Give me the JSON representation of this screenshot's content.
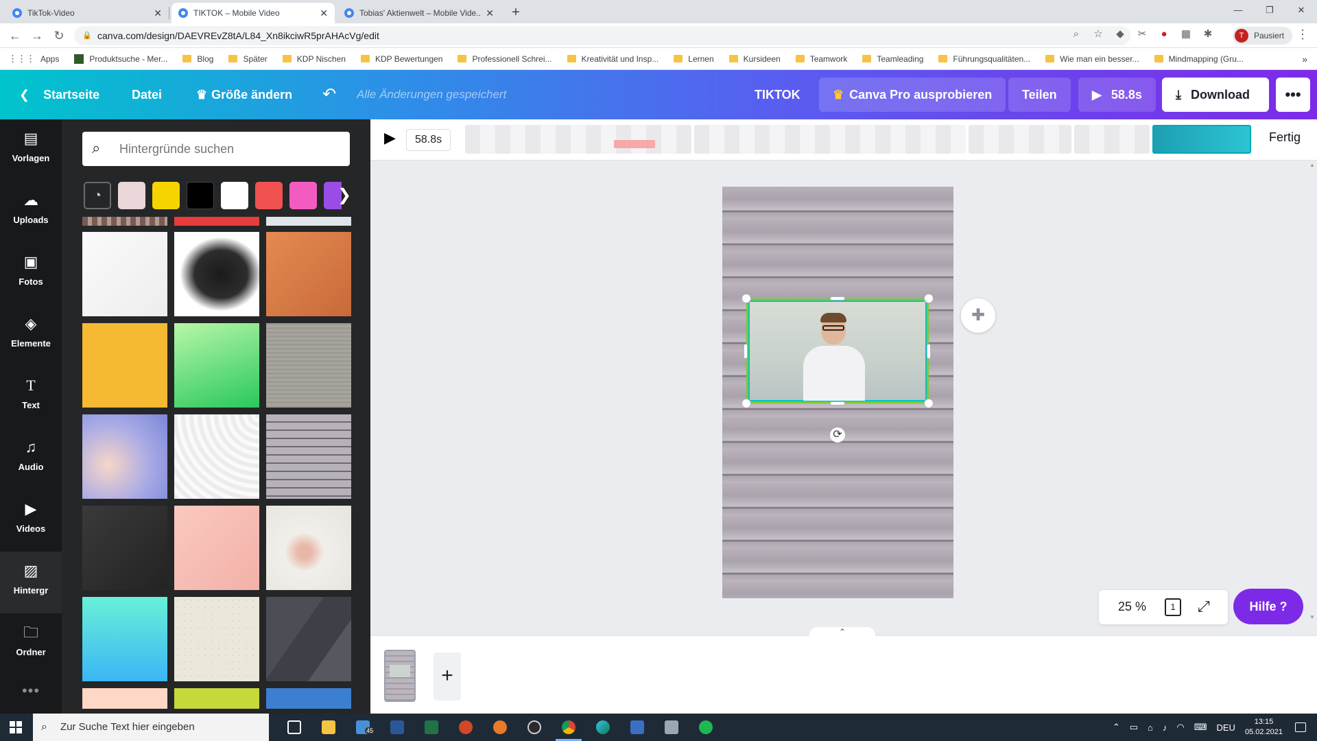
{
  "browser": {
    "tabs": [
      {
        "label": "TikTok-Video",
        "active": false
      },
      {
        "label": "TIKTOK – Mobile Video",
        "active": true
      },
      {
        "label": "Tobias' Aktienwelt – Mobile Vide...",
        "active": false
      }
    ],
    "url": "canva.com/design/DAEVREvZ8tA/L84_Xn8ikciwR5prAHAcVg/edit",
    "profile": {
      "initial": "T",
      "status": "Pausiert"
    },
    "bookmarks": [
      "Apps",
      "Produktsuche - Mer...",
      "Blog",
      "Später",
      "KDP Nischen",
      "KDP Bewertungen",
      "Professionell Schrei...",
      "Kreativität und Insp...",
      "Lernen",
      "Kursideen",
      "Teamwork",
      "Teamleading",
      "Führungsqualitäten...",
      "Wie man ein besser...",
      "Mindmapping  (Gru..."
    ]
  },
  "topbar": {
    "back_label": "Startseite",
    "file_label": "Datei",
    "resize_label": "Größe ändern",
    "saved_status": "Alle Änderungen gespeichert",
    "design_name": "TIKTOK",
    "pro_label": "Canva Pro ausprobieren",
    "share_label": "Teilen",
    "play_duration": "58.8s",
    "download_label": "Download"
  },
  "rail": [
    {
      "name": "templates",
      "label": "Vorlagen",
      "icon": "layout-icon"
    },
    {
      "name": "uploads",
      "label": "Uploads",
      "icon": "cloud-upload-icon"
    },
    {
      "name": "photos",
      "label": "Fotos",
      "icon": "image-icon"
    },
    {
      "name": "elements",
      "label": "Elemente",
      "icon": "shapes-icon"
    },
    {
      "name": "text",
      "label": "Text",
      "icon": "text-icon"
    },
    {
      "name": "audio",
      "label": "Audio",
      "icon": "music-note-icon"
    },
    {
      "name": "videos",
      "label": "Videos",
      "icon": "video-icon"
    },
    {
      "name": "backgrounds",
      "label": "Hintergr",
      "icon": "hatch-pattern-icon",
      "active": true
    },
    {
      "name": "folders",
      "label": "Ordner",
      "icon": "folder-icon"
    }
  ],
  "panel": {
    "search_placeholder": "Hintergründe suchen",
    "swatches": [
      "#e8d6d9",
      "#f5d400",
      "#000000",
      "#ffffff",
      "#f05252",
      "#f25cc1",
      "#9a4de6"
    ]
  },
  "timeline": {
    "duration": "58.8s",
    "done_label": "Fertig"
  },
  "canvas": {
    "zoom": "25 %",
    "page_number": "1",
    "help_label": "Hilfe ?"
  },
  "taskbar": {
    "search_placeholder": "Zur Suche Text hier eingeben",
    "mail_badge": "45",
    "language": "DEU",
    "time": "13:15",
    "date": "05.02.2021"
  },
  "colors": {
    "brand_purple": "#7d2ae8",
    "brand_teal": "#00c4cc",
    "selection_green": "#7ec832",
    "rail_bg": "#18191b",
    "panel_bg": "#252627"
  }
}
